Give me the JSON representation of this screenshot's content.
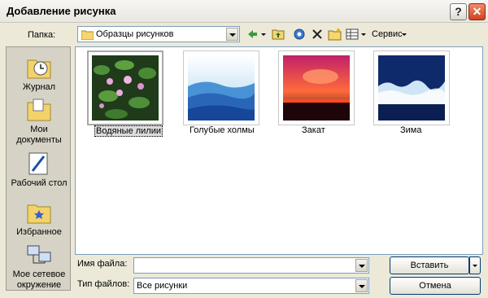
{
  "window": {
    "title": "Добавление рисунка"
  },
  "titlebar_buttons": {
    "help": "?",
    "close": "✕"
  },
  "toolbar": {
    "folder_label": "Папка:",
    "folder_value": "Образцы рисунков",
    "service_label": "Сервис"
  },
  "places": [
    {
      "label": "Журнал"
    },
    {
      "label": "Мои документы"
    },
    {
      "label": "Рабочий стол"
    },
    {
      "label": "Избранное"
    },
    {
      "label": "Мое сетевое окружение"
    }
  ],
  "files": [
    {
      "name": "Водяные лилии",
      "selected": true
    },
    {
      "name": "Голубые холмы",
      "selected": false
    },
    {
      "name": "Закат",
      "selected": false
    },
    {
      "name": "Зима",
      "selected": false
    }
  ],
  "bottom": {
    "filename_label": "Имя файла:",
    "filename_value": "",
    "filetype_label": "Тип файлов:",
    "filetype_value": "Все рисунки",
    "insert_button": "Вставить",
    "cancel_button": "Отмена"
  }
}
